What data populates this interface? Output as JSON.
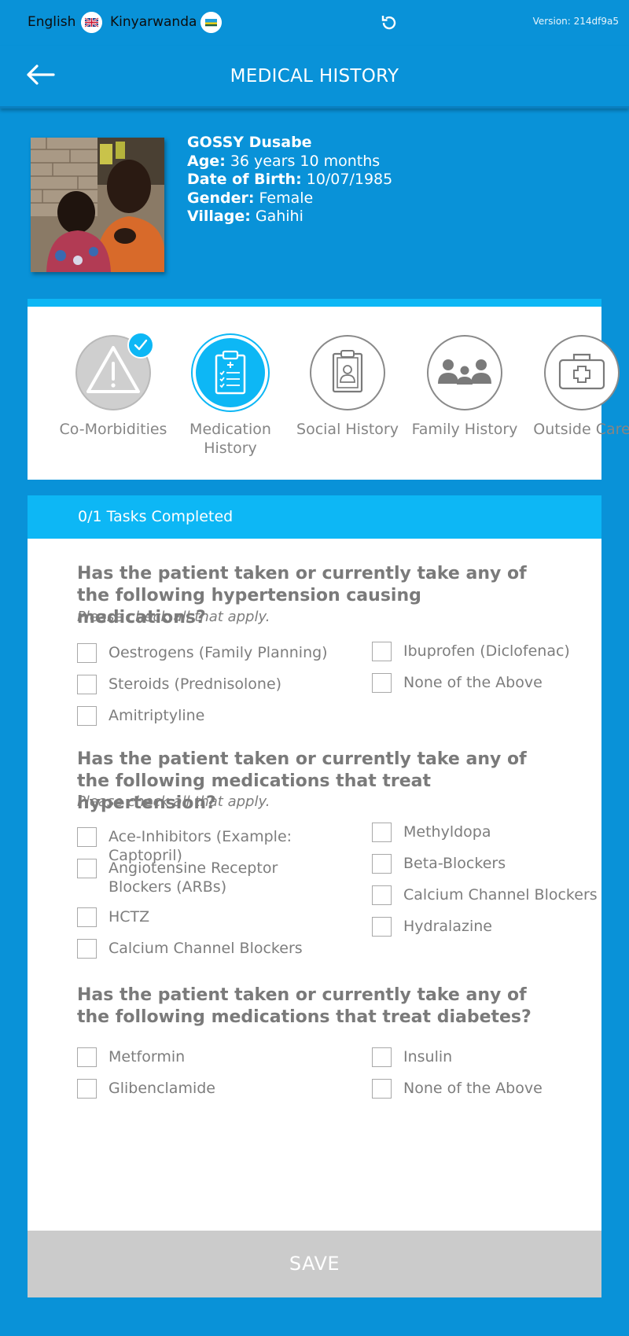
{
  "topbar": {
    "lang_en": "English",
    "lang_rw": "Kinyarwanda",
    "version": "Version: 214df9a5"
  },
  "header": {
    "title": "MEDICAL HISTORY"
  },
  "patient": {
    "name": "GOSSY Dusabe",
    "age_label": "Age:",
    "age": " 36 years 10 months",
    "dob_label": "Date of Birth:",
    "dob": " 10/07/1985",
    "gender_label": "Gender:",
    "gender": " Female",
    "village_label": "Village:",
    "village": " Gahihi"
  },
  "tabs": [
    {
      "label": "Co-Morbidities",
      "icon": "warning-icon",
      "state": "done"
    },
    {
      "label": "Medication\nHistory",
      "icon": "clipboard-list-icon",
      "state": "active"
    },
    {
      "label": "Social History",
      "icon": "id-card-icon",
      "state": "default"
    },
    {
      "label": "Family History",
      "icon": "family-icon",
      "state": "default"
    },
    {
      "label": "Outside Care",
      "icon": "medical-kit-icon",
      "state": "default"
    }
  ],
  "tasks": {
    "completed": "0/1 Tasks Completed"
  },
  "questions": [
    {
      "text": "Has the patient taken or currently take any of the following hypertension causing medications?",
      "hint": "Please check all that apply.",
      "left": [
        "Oestrogens (Family Planning)",
        "Steroids (Prednisolone)",
        "Amitriptyline"
      ],
      "right": [
        "Ibuprofen (Diclofenac)",
        "None of the Above"
      ]
    },
    {
      "text": "Has the patient taken or currently take any of the following medications that treat hypertension?",
      "hint": "Please check all that apply.",
      "left": [
        "Ace-Inhibitors (Example: Captopril)",
        "Angiotensine Receptor Blockers (ARBs)",
        "HCTZ",
        "Calcium Channel Blockers"
      ],
      "right": [
        "Methyldopa",
        "Beta-Blockers",
        "Calcium Channel Blockers",
        "Hydralazine"
      ]
    },
    {
      "text": "Has the patient taken or currently take any of the following medications that treat diabetes?",
      "left": [
        "Metformin",
        "Glibenclamide"
      ],
      "right": [
        "Insulin",
        "None of the Above"
      ]
    }
  ],
  "actions": {
    "save": "SAVE"
  },
  "colors": {
    "primary": "#0992d8",
    "accent": "#0db7f5",
    "disabled": "#cbcbcb"
  }
}
